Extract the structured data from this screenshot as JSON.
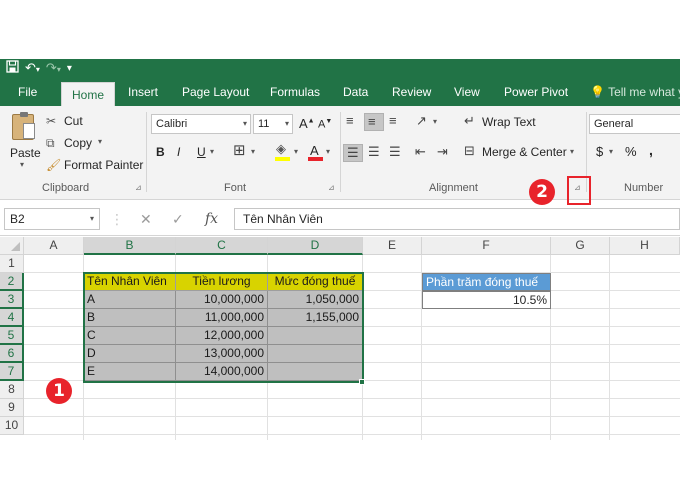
{
  "quick_access": {
    "save_icon": "save-icon",
    "undo_icon": "undo-icon",
    "redo_icon": "redo-icon",
    "customize_icon": "customize-icon"
  },
  "tabs": [
    "File",
    "Home",
    "Insert",
    "Page Layout",
    "Formulas",
    "Data",
    "Review",
    "View",
    "Power Pivot"
  ],
  "tell_me": "Tell me what yo",
  "clipboard": {
    "paste": "Paste",
    "cut": "Cut",
    "copy": "Copy",
    "format_painter": "Format Painter",
    "label": "Clipboard"
  },
  "font": {
    "name": "Calibri",
    "size": "11",
    "bold": "B",
    "italic": "I",
    "underline": "U",
    "grow": "A",
    "shrink": "A",
    "label": "Font"
  },
  "alignment": {
    "wrap_text": "Wrap Text",
    "merge_center": "Merge & Center",
    "label": "Alignment"
  },
  "number": {
    "format": "General",
    "currency": "$",
    "percent": "%",
    "comma": ",",
    "label": "Number"
  },
  "formula_bar": {
    "name_box": "B2",
    "cancel": "✕",
    "enter": "✓",
    "fx": "fx",
    "content": "Tên Nhân Viên"
  },
  "columns": [
    "A",
    "B",
    "C",
    "D",
    "E",
    "F",
    "G",
    "H"
  ],
  "rows": [
    "1",
    "2",
    "3",
    "4",
    "5",
    "6",
    "7",
    "8",
    "9",
    "10"
  ],
  "table": {
    "headers": [
      "Tên Nhân Viên",
      "Tiền lương",
      "Mức đóng thuế"
    ],
    "rows": [
      [
        "A",
        "10,000,000",
        "1,050,000"
      ],
      [
        "B",
        "11,000,000",
        "1,155,000"
      ],
      [
        "C",
        "12,000,000",
        ""
      ],
      [
        "D",
        "13,000,000",
        ""
      ],
      [
        "E",
        "14,000,000",
        ""
      ]
    ]
  },
  "tax": {
    "header": "Phần trăm đóng thuế",
    "value": "10.5%"
  },
  "annotations": {
    "one": "1",
    "two": "2"
  },
  "colors": {
    "excel_green": "#217346",
    "header_yellow": "#d8d300",
    "tax_blue": "#5b9bd5",
    "selection_gray": "#bfbfbf",
    "annotation_red": "#e8232b"
  }
}
